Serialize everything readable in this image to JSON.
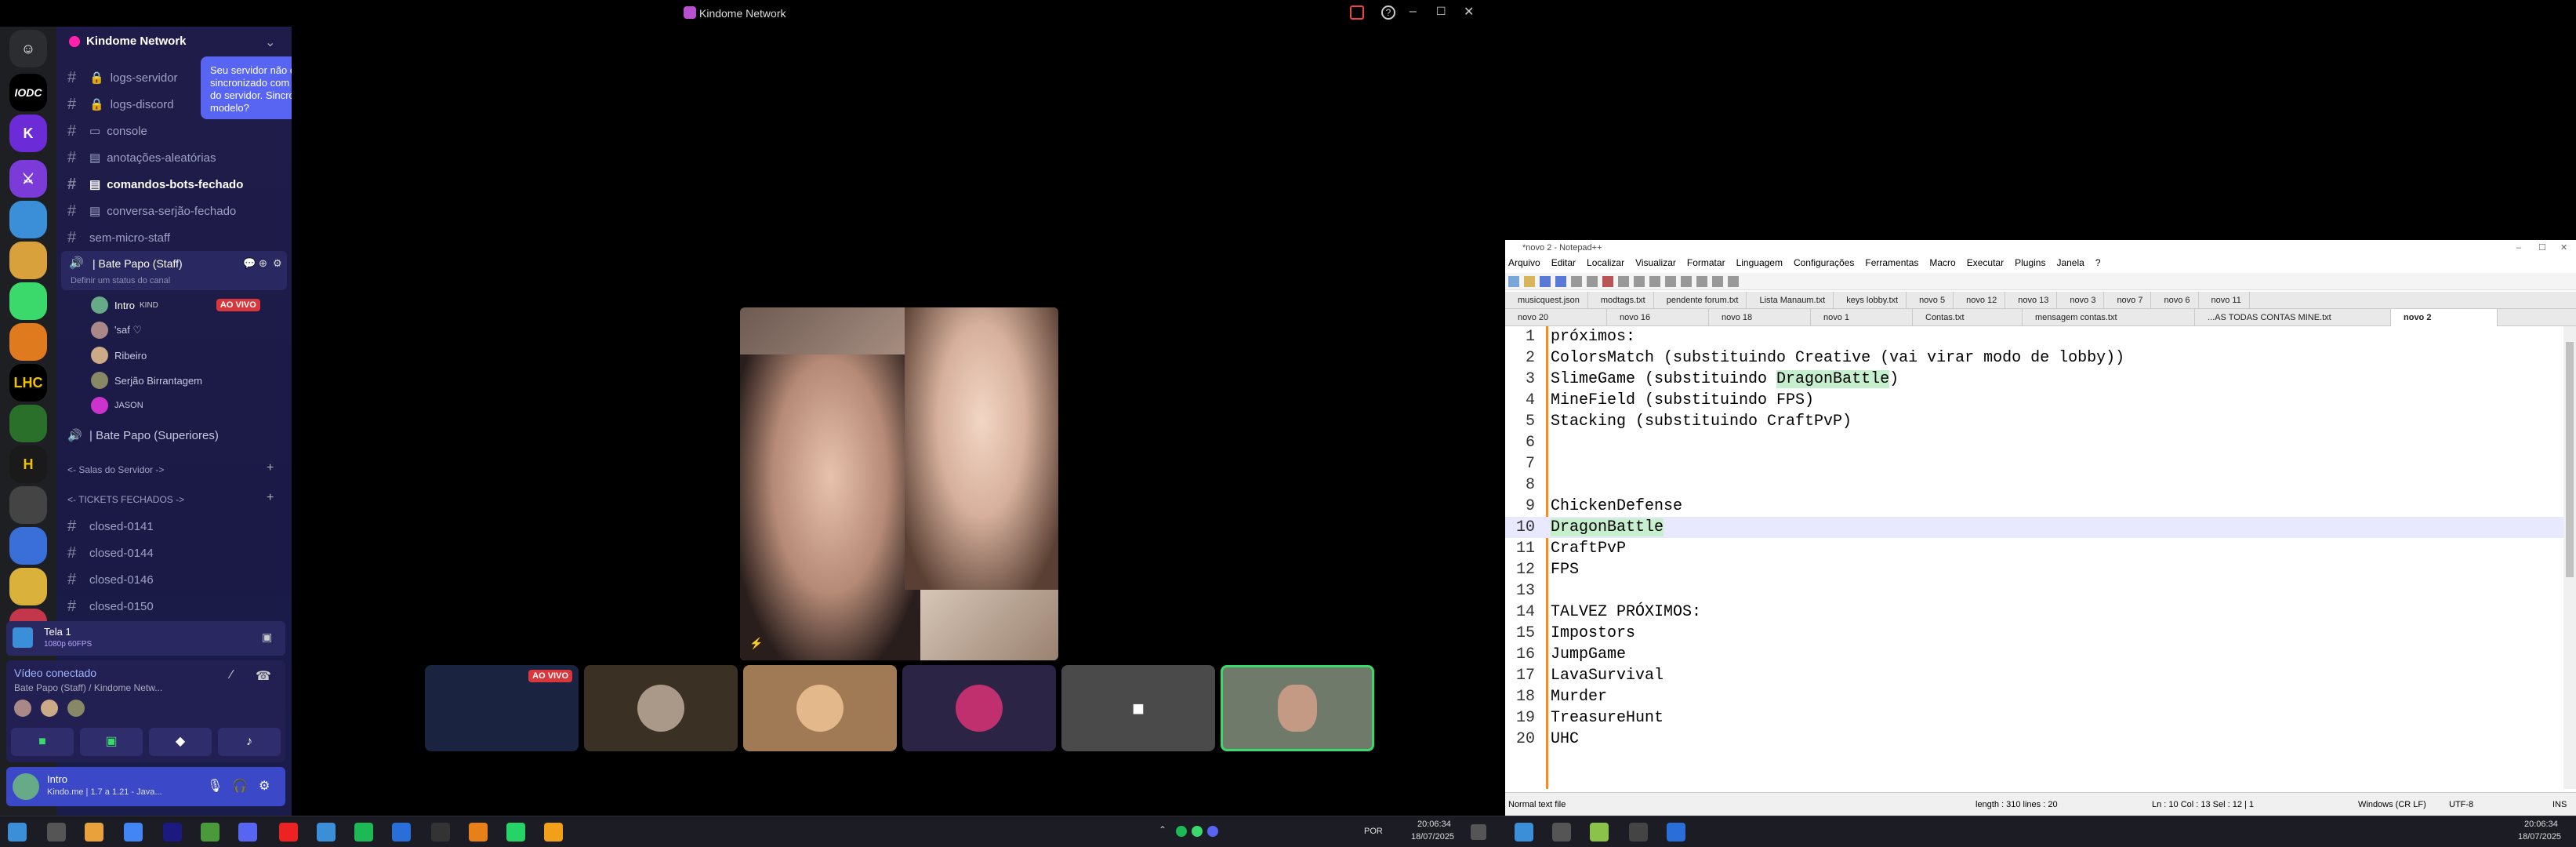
{
  "discord": {
    "window_title": "Kindome Network",
    "server_name": "Kindome Network",
    "tooltip": "Seu servidor não está sincronizado com o modelo do servidor. Sincronizar modelo?",
    "channels": [
      {
        "name": "logs-servidor",
        "locked": true
      },
      {
        "name": "logs-discord",
        "locked": true
      },
      {
        "name": "console"
      },
      {
        "name": "anotações-aleatórias"
      },
      {
        "name": "comandos-bots-fechado",
        "bold": true
      },
      {
        "name": "conversa-serjão-fechado"
      },
      {
        "name": "sem-micro-staff"
      }
    ],
    "voice_channel": "| Bate Papo (Staff)",
    "voice_status_placeholder": "Definir um status do canal",
    "voice_users": [
      {
        "name": "Intro",
        "tag": "KIND",
        "live": "AO VIVO"
      },
      {
        "name": "'saf ♡"
      },
      {
        "name": "Ribeiro"
      },
      {
        "name": "Serjão Birrantagem"
      },
      {
        "name": "JASON"
      }
    ],
    "voice_channel_2": "| Bate Papo (Superiores)",
    "category_1": "<- Salas do Servidor -> ",
    "category_2": "<- TICKETS FECHADOS -> ",
    "tickets": [
      "closed-0141",
      "closed-0144",
      "closed-0146",
      "closed-0150"
    ],
    "stream_title": "Tela 1",
    "stream_quality": "1080p 60FPS",
    "voice_connected": "Vídeo conectado",
    "voice_location": "Bate Papo (Staff) / Kindome Netw...",
    "user_name": "Intro",
    "user_status": "Kindo.me | 1.7 a 1.21 - Java...",
    "tile_live": "AO VIVO",
    "server_rail": [
      "IODC",
      "LHC",
      "H"
    ]
  },
  "notepad": {
    "title": "*novo 2 - Notepad++",
    "menu": [
      "Arquivo",
      "Editar",
      "Localizar",
      "Visualizar",
      "Formatar",
      "Linguagem",
      "Configurações",
      "Ferramentas",
      "Macro",
      "Executar",
      "Plugins",
      "Janela",
      "?"
    ],
    "tabs_row1": [
      "musicquest.json",
      "modtags.txt",
      "pendente forum.txt",
      "Lista Manaum.txt",
      "keys lobby.txt",
      "novo 5",
      "novo 12",
      "novo 13",
      "novo 3",
      "novo 7",
      "novo 6",
      "novo 11"
    ],
    "tabs_row2": [
      "novo 20",
      "novo 16",
      "novo 18",
      "novo 1",
      "Contas.txt",
      "mensagem contas.txt",
      "...AS TODAS CONTAS MINE.txt",
      "novo 2"
    ],
    "lines": [
      "próximos:",
      "ColorsMatch (substituindo Creative (vai virar modo de lobby))",
      "SlimeGame (substituindo DragonBattle)",
      "MineField (substituindo FPS)",
      "Stacking (substituindo CraftPvP)",
      "",
      "",
      "",
      "ChickenDefense",
      "DragonBattle",
      "CraftPvP",
      "FPS",
      "",
      "TALVEZ PRÓXIMOS:",
      "Impostors",
      "JumpGame",
      "LavaSurvival",
      "Murder",
      "TreasureHunt",
      "UHC"
    ],
    "line_numbers": [
      "1",
      "2",
      "3",
      "4",
      "5",
      "6",
      "7",
      "8",
      "9",
      "10",
      "11",
      "12",
      "13",
      "14",
      "15",
      "16",
      "17",
      "18",
      "19",
      "20"
    ],
    "status_type": "Normal text file",
    "status_length": "length : 310    lines : 20",
    "status_pos": "Ln : 10    Col : 13    Sel : 12 | 1",
    "status_eol": "Windows (CR LF)",
    "status_enc": "UTF-8",
    "status_ins": "INS"
  },
  "taskbar": {
    "lang": "POR",
    "time_left": "20:06:34",
    "date_left": "18/07/2025",
    "time_right": "20:06:34",
    "date_right": "18/07/2025"
  },
  "colors": {
    "accent": "#5865f2",
    "live": "#da373c",
    "sidebar": "#1e1c48",
    "highlight": "#c6efce"
  }
}
